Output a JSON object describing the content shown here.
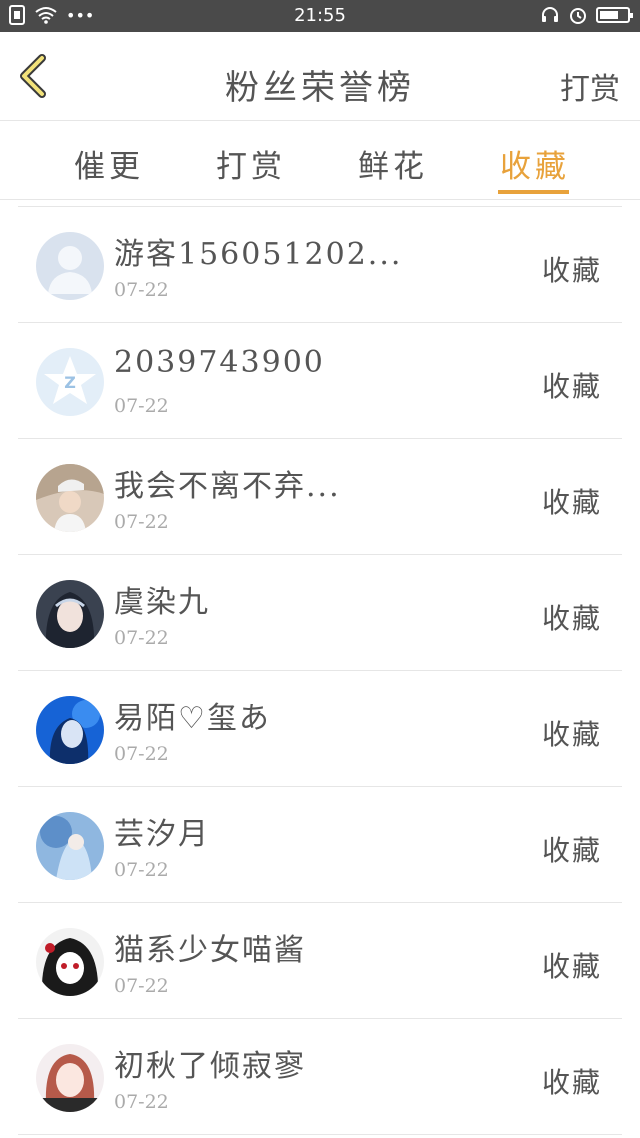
{
  "status_bar": {
    "time": "21:55",
    "dots": "•••"
  },
  "header": {
    "title": "粉丝荣誉榜",
    "right_link": "打赏"
  },
  "tabs": [
    {
      "label": "催更",
      "active": false
    },
    {
      "label": "打赏",
      "active": false
    },
    {
      "label": "鲜花",
      "active": false
    },
    {
      "label": "收藏",
      "active": true
    }
  ],
  "colors": {
    "accent": "#e8a23b",
    "text": "#555555",
    "muted": "#aaaaaa",
    "status_bar": "#4a4a4a"
  },
  "fans": [
    {
      "name": "游客156051202...",
      "date": "07-22",
      "action": "收藏",
      "avatar": "default-user-avatar"
    },
    {
      "name": "2039743900",
      "date": "07-22",
      "action": "收藏",
      "avatar": "qq-logo-avatar"
    },
    {
      "name": "我会不离不弃...",
      "date": "07-22",
      "action": "收藏",
      "avatar": "photo-avatar"
    },
    {
      "name": "虞染九",
      "date": "07-22",
      "action": "收藏",
      "avatar": "photo-avatar"
    },
    {
      "name": "易陌♡玺あ",
      "date": "07-22",
      "action": "收藏",
      "avatar": "photo-avatar"
    },
    {
      "name": "芸汐月",
      "date": "07-22",
      "action": "收藏",
      "avatar": "photo-avatar"
    },
    {
      "name": "猫系少女喵酱",
      "date": "07-22",
      "action": "收藏",
      "avatar": "photo-avatar"
    },
    {
      "name": "初秋了倾寂寥",
      "date": "07-22",
      "action": "收藏",
      "avatar": "photo-avatar"
    }
  ]
}
